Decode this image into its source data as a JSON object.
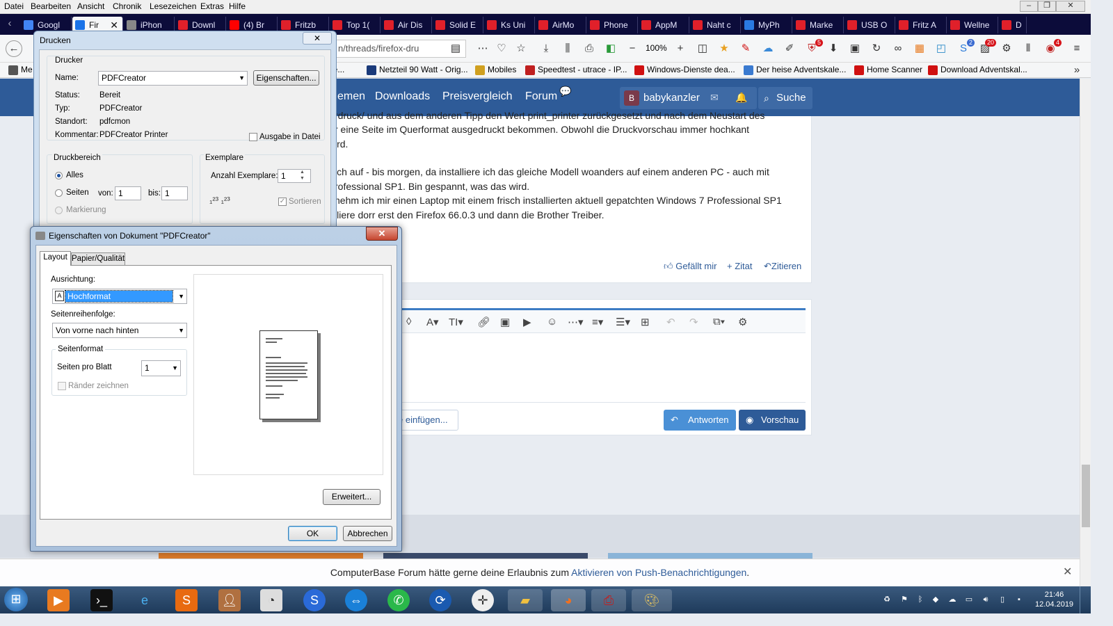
{
  "firefox": {
    "menu": [
      "Datei",
      "Bearbeiten",
      "Ansicht",
      "Chronik",
      "Lesezeichen",
      "Extras",
      "Hilfe"
    ],
    "tabs": [
      {
        "label": "Googl",
        "color": "#4285f4"
      },
      {
        "label": "Fir",
        "color": "#1a73e8",
        "active": true
      },
      {
        "label": "iPhon",
        "color": "#888888"
      },
      {
        "label": "Downl",
        "color": "#e0202a"
      },
      {
        "label": "(4) Br",
        "color": "#ff0000"
      },
      {
        "label": "Fritzb",
        "color": "#e0202a"
      },
      {
        "label": "Top 1(",
        "color": "#e0202a"
      },
      {
        "label": "Air Dis",
        "color": "#e0202a"
      },
      {
        "label": "Solid E",
        "color": "#e0202a"
      },
      {
        "label": "Ks Uni",
        "color": "#e0202a"
      },
      {
        "label": "AirMo",
        "color": "#e0202a"
      },
      {
        "label": "Phone",
        "color": "#e0202a"
      },
      {
        "label": "AppM",
        "color": "#e0202a"
      },
      {
        "label": "Naht c",
        "color": "#e0202a"
      },
      {
        "label": "MyPh",
        "color": "#2a7ae2"
      },
      {
        "label": "Marke",
        "color": "#e0202a"
      },
      {
        "label": "USB O",
        "color": "#e0202a"
      },
      {
        "label": "Fritz A",
        "color": "#e0202a"
      },
      {
        "label": "Wellne",
        "color": "#e0202a"
      },
      {
        "label": "D",
        "color": "#e0202a"
      }
    ],
    "url": "n/threads/firefox-dru",
    "zoom": "100%",
    "badges": {
      "ext1": "5",
      "ext2": "2",
      "ext3": "20",
      "ext4": "4"
    },
    "bookmarks": [
      {
        "label": "Me",
        "color": "#555555"
      },
      {
        "label": "dre...",
        "color": "#888888"
      },
      {
        "label": "Netzteil 90 Watt - Orig...",
        "color": "#1a3a7a"
      },
      {
        "label": "Mobiles",
        "color": "#d0a020"
      },
      {
        "label": "Speedtest - utrace - IP...",
        "color": "#c02020"
      },
      {
        "label": "Windows-Dienste dea...",
        "color": "#d01010"
      },
      {
        "label": "Der heise Adventskale...",
        "color": "#3a7ad0"
      },
      {
        "label": "Home Scanner",
        "color": "#d01010"
      },
      {
        "label": "Download Adventskal...",
        "color": "#d01010"
      }
    ]
  },
  "site": {
    "nav": [
      "emen",
      "Downloads",
      "Preisvergleich",
      "Forum"
    ],
    "user_initial": "B",
    "username": "babykanzler",
    "search": "Suche",
    "post_lines": [
      "rdruck/ und aus dem anderen Tipp den Wert print_printer zurückgesetzt und nach dem Neustart des",
      "r eine Seite im Querformat ausgedruckt bekommen. Obwohl die Druckvorschau immer hochkant",
      "ird.",
      "",
      "ich auf - bis morgen, da installiere ich das gleiche Modell woanders auf einem anderen PC - auch mit",
      "rofessional SP1. Bin gespannt, was das wird.",
      "nehm ich mir einen Laptop mit einem frisch installierten aktuell gepatchten Windows 7 Professional SP1",
      "lliere dorr erst den Firefox 66.0.3 und dann die Brother Treiber."
    ],
    "actions": {
      "like": "Gefällt mir",
      "quote_plus": "+ Zitat",
      "quote": "Zitieren"
    },
    "attach": "e einfügen...",
    "reply": "Antworten",
    "preview": "Vorschau",
    "push_text": "ComputerBase Forum hätte gerne deine Erlaubnis zum",
    "push_link": "Aktivieren von Push-Benachrichtigungen",
    "push_end": "."
  },
  "print_dialog": {
    "title": "Drucken",
    "printer_group": "Drucker",
    "name_label": "Name:",
    "name_value": "PDFCreator",
    "properties_button": "Eigenschaften...",
    "status_label": "Status:",
    "status_value": "Bereit",
    "type_label": "Typ:",
    "type_value": "PDFCreator",
    "location_label": "Standort:",
    "location_value": "pdfcmon",
    "comment_label": "Kommentar:",
    "comment_value": "PDFCreator Printer",
    "to_file": "Ausgabe in Datei",
    "range_group": "Druckbereich",
    "all": "Alles",
    "pages": "Seiten",
    "from_label": "von:",
    "from_value": "1",
    "to_label": "bis:",
    "to_value": "1",
    "selection": "Markierung",
    "copies_group": "Exemplare",
    "copies_label": "Anzahl Exemplare:",
    "copies_value": "1",
    "collate": "Sortieren"
  },
  "properties_dialog": {
    "title": "Eigenschaften von Dokument \"PDFCreator\"",
    "tabs": [
      "Layout",
      "Papier/Qualität"
    ],
    "orientation_label": "Ausrichtung:",
    "orientation_value": "Hochformat",
    "page_order_label": "Seitenreihenfolge:",
    "page_order_value": "Von vorne nach hinten",
    "page_format_group": "Seitenformat",
    "pages_per_sheet_label": "Seiten pro Blatt",
    "pages_per_sheet_value": "1",
    "draw_borders": "Ränder zeichnen",
    "advanced_button": "Erweitert...",
    "ok_button": "OK",
    "cancel_button": "Abbrechen"
  },
  "taskbar": {
    "time": "21:46",
    "date": "12.04.2019"
  }
}
